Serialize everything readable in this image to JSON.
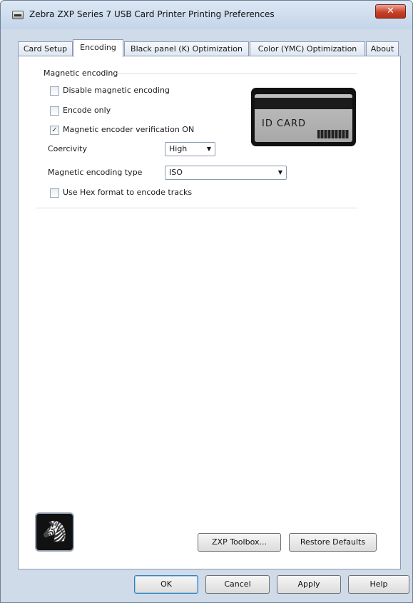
{
  "window": {
    "title": "Zebra ZXP Series 7 USB Card Printer Printing Preferences",
    "close_glyph": "✕",
    "icon": "printer-icon"
  },
  "tabs": [
    {
      "label": "Card Setup",
      "active": false
    },
    {
      "label": "Encoding",
      "active": true
    },
    {
      "label": "Black panel (K) Optimization",
      "active": false
    },
    {
      "label": "Color (YMC) Optimization",
      "active": false
    },
    {
      "label": "About",
      "active": false
    }
  ],
  "magnetic_encoding": {
    "group_label": "Magnetic encoding",
    "disable": {
      "label": "Disable magnetic encoding",
      "checked": false
    },
    "encode_only": {
      "label": "Encode only",
      "checked": false
    },
    "verification": {
      "label": "Magnetic encoder verification ON",
      "checked": true
    },
    "coercivity": {
      "label": "Coercivity",
      "value": "High"
    },
    "encoding_type": {
      "label": "Magnetic encoding type",
      "value": "ISO"
    },
    "hex_format": {
      "label": "Use Hex format to encode tracks",
      "checked": false
    },
    "card_image_text": "ID CARD"
  },
  "footer": {
    "toolbox_label": "ZXP Toolbox...",
    "restore_label": "Restore Defaults",
    "ok_label": "OK",
    "cancel_label": "Cancel",
    "apply_label": "Apply",
    "help_label": "Help"
  },
  "colors": {
    "window_frame": "#cfdbe9",
    "close_button": "#c8412a",
    "default_button_border": "#3c7fb1"
  }
}
